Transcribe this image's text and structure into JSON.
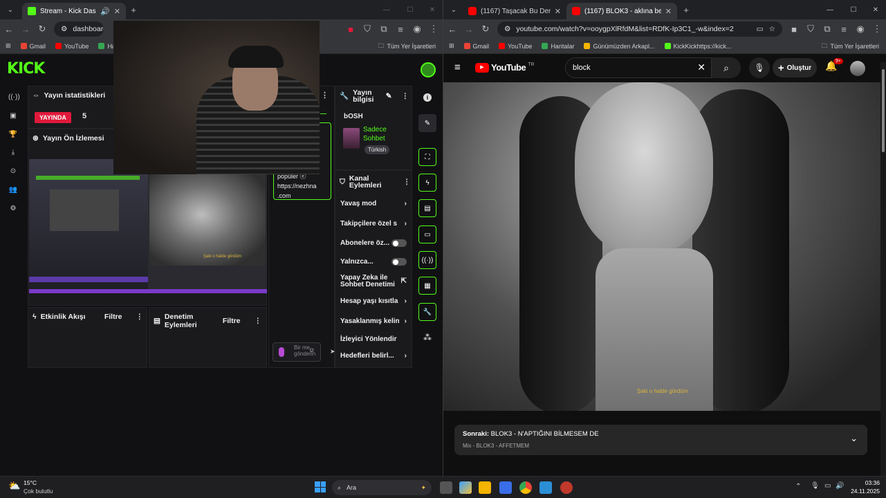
{
  "left_window": {
    "tabs": [
      {
        "title": "Stream - Kick Dashboard",
        "active": true
      },
      {
        "title": "",
        "active": false
      }
    ],
    "url": "dashboard.kick",
    "bookmarks": [
      "Gmail",
      "YouTube",
      "Ha"
    ],
    "bookmarks_right": "Tüm Yer İşaretleri"
  },
  "kick": {
    "logo": "KICK",
    "stats_title": "Yayın istatistikleri",
    "live_badge": "YAYINDA",
    "viewer_count": "5",
    "preview_title": "Yayın Ön İzlemesi",
    "stream_info_title": "Yayın bilgisi",
    "stream_title": "bOSH",
    "category": "Sadece Sohbet",
    "language_tag": "Türkish",
    "channel_actions_title": "Kanal Eylemleri",
    "actions": [
      {
        "label": "Yavaş mod",
        "control": "chevron"
      },
      {
        "label": "Takipçilere özel s",
        "control": "chevron"
      },
      {
        "label": "Abonelere öz...",
        "control": "toggle"
      },
      {
        "label": "Yalnızca...",
        "control": "toggle"
      },
      {
        "label": "Yapay Zeka ile Sohbet Denetimi",
        "control": "ext"
      },
      {
        "label": "Hesap yaşı kısıtla",
        "control": "chevron"
      },
      {
        "label": "Yasaklanmış kelin",
        "control": "chevron"
      },
      {
        "label": "İzleyici Yönlendir",
        "control": "none"
      },
      {
        "label": "Hedefleri belirl...",
        "control": "chevron"
      }
    ],
    "activity_title": "Etkinlik Akışı",
    "moderation_title": "Denetim Eylemleri",
    "filter_label": "Filtre",
    "chat_snippet_lines": [
      "popüler ⓔ",
      "https://nezhna",
      ".com"
    ],
    "chat_fragment_1": "r —",
    "chat_fragment_2": "orpa",
    "chat_placeholder": "Bir me... gönderin",
    "preview_caption": "Şaki o halde gördüm",
    "colors": {
      "brand": "#53fc18",
      "live": "#e0193b"
    }
  },
  "right_window": {
    "tabs": [
      {
        "title": "(1167) Taşacak Bu Deniz 7. Bölü",
        "active": false
      },
      {
        "title": "(1167) BLOK3 - aklına beni geli",
        "active": true
      }
    ],
    "url": "youtube.com/watch?v=ooygpXlRfdM&list=RDfK-Ip3C1_-w&index=2",
    "bookmarks": [
      "Gmail",
      "YouTube",
      "Haritalar",
      "Günümüzden Arkapl...",
      "KickKickhttps://kick..."
    ],
    "bookmarks_right": "Tüm Yer İşaretleri"
  },
  "youtube": {
    "logo": "YouTube",
    "country": "TR",
    "search_value": "block",
    "create_label": "Oluştur",
    "notif_count": "9+",
    "subtitle": "Şaki o halde gördüm",
    "next_label": "Sonraki:",
    "next_title": "BLOK3 - N'APTIĞINI BİLMESEM DE",
    "mix_label": "Mix - BLOK3 - AFFETMEM"
  },
  "taskbar": {
    "temperature": "15°C",
    "weather": "Çok bulutlu",
    "search_label": "Ara",
    "time": "03:36",
    "date": "24.11.2025"
  }
}
